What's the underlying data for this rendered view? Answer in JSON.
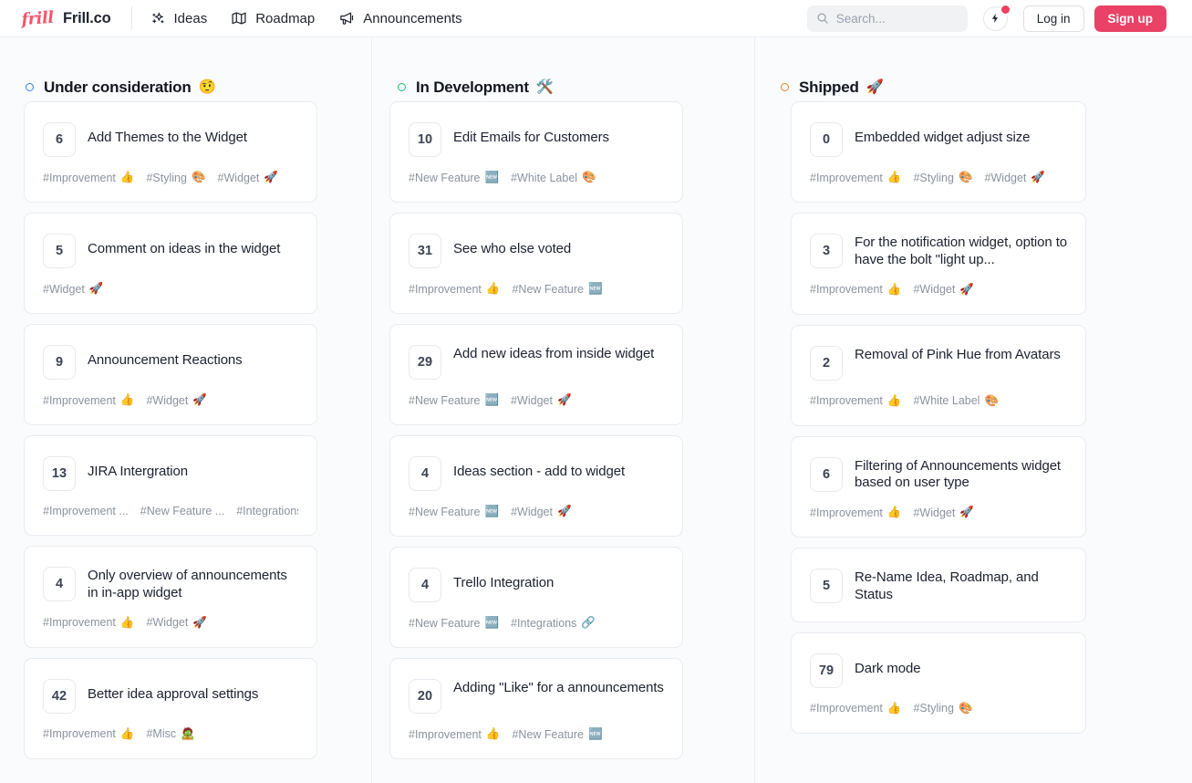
{
  "header": {
    "logo_icon": "frill-script-logo",
    "logo_text": "frill",
    "brand": "Frill.co",
    "nav": [
      {
        "label": "Ideas",
        "icon": "sparkles-icon"
      },
      {
        "label": "Roadmap",
        "icon": "map-icon"
      },
      {
        "label": "Announcements",
        "icon": "megaphone-icon"
      }
    ],
    "search": {
      "placeholder": "Search...",
      "value": "",
      "icon": "search-icon"
    },
    "bolt": {
      "icon": "bolt-icon",
      "has_notification": true,
      "dot_color": "#ef3e63"
    },
    "login_label": "Log in",
    "signup_label": "Sign up",
    "signup_color": "#e94266"
  },
  "board": {
    "columns": [
      {
        "title": "Under consideration",
        "emoji": "🤨",
        "emoji_name": "face-with-raised-eyebrow",
        "dot_color": "#2f7df4",
        "cards": [
          {
            "votes": "6",
            "title": "Add Themes to the Widget",
            "tags": [
              {
                "label": "#Improvement",
                "emoji": "👍"
              },
              {
                "label": "#Styling",
                "emoji": "🎨"
              },
              {
                "label": "#Widget",
                "emoji": "🚀"
              }
            ]
          },
          {
            "votes": "5",
            "title": "Comment on ideas in the widget",
            "tags": [
              {
                "label": "#Widget",
                "emoji": "🚀"
              }
            ]
          },
          {
            "votes": "9",
            "title": "Announcement Reactions",
            "tags": [
              {
                "label": "#Improvement",
                "emoji": "👍"
              },
              {
                "label": "#Widget",
                "emoji": "🚀"
              }
            ]
          },
          {
            "votes": "13",
            "title": "JIRA Intergration",
            "tags": [
              {
                "label": "#Improvement ...",
                "emoji": ""
              },
              {
                "label": "#New Feature ...",
                "emoji": ""
              },
              {
                "label": "#Integrations ...",
                "emoji": ""
              }
            ]
          },
          {
            "votes": "4",
            "title": "Only overview of announcements in in-app widget",
            "two_line": true,
            "tags": [
              {
                "label": "#Improvement",
                "emoji": "👍"
              },
              {
                "label": "#Widget",
                "emoji": "🚀"
              }
            ]
          },
          {
            "votes": "42",
            "title": "Better idea approval settings",
            "tags": [
              {
                "label": "#Improvement",
                "emoji": "👍"
              },
              {
                "label": "#Misc",
                "emoji": "🧟"
              }
            ]
          }
        ]
      },
      {
        "title": "In Development",
        "emoji": "🛠️",
        "emoji_name": "hammer-and-wrench",
        "dot_color": "#16c172",
        "cards": [
          {
            "votes": "10",
            "title": "Edit Emails for Customers",
            "tags": [
              {
                "label": "#New Feature",
                "emoji": "🆕"
              },
              {
                "label": "#White Label",
                "emoji": "🎨"
              }
            ]
          },
          {
            "votes": "31",
            "title": "See who else voted",
            "tags": [
              {
                "label": "#Improvement",
                "emoji": "👍"
              },
              {
                "label": "#New Feature",
                "emoji": "🆕"
              }
            ]
          },
          {
            "votes": "29",
            "title": "Add new ideas from inside widget",
            "two_line": true,
            "tags": [
              {
                "label": "#New Feature",
                "emoji": "🆕"
              },
              {
                "label": "#Widget",
                "emoji": "🚀"
              }
            ]
          },
          {
            "votes": "4",
            "title": "Ideas section - add to widget",
            "tags": [
              {
                "label": "#New Feature",
                "emoji": "🆕"
              },
              {
                "label": "#Widget",
                "emoji": "🚀"
              }
            ]
          },
          {
            "votes": "4",
            "title": "Trello Integration",
            "tags": [
              {
                "label": "#New Feature",
                "emoji": "🆕"
              },
              {
                "label": "#Integrations",
                "emoji": "🔗"
              }
            ]
          },
          {
            "votes": "20",
            "title": "Adding \"Like\" for a announcements",
            "two_line": true,
            "tags": [
              {
                "label": "#Improvement",
                "emoji": "👍"
              },
              {
                "label": "#New Feature",
                "emoji": "🆕"
              }
            ]
          }
        ]
      },
      {
        "title": "Shipped",
        "emoji": "🚀",
        "emoji_name": "rocket",
        "dot_color": "#f08324",
        "cards": [
          {
            "votes": "0",
            "title": "Embedded widget adjust size",
            "tags": [
              {
                "label": "#Improvement",
                "emoji": "👍"
              },
              {
                "label": "#Styling",
                "emoji": "🎨"
              },
              {
                "label": "#Widget",
                "emoji": "🚀"
              }
            ]
          },
          {
            "votes": "3",
            "title": "For the notification widget, option to have the bolt \"light up...",
            "two_line": true,
            "tags": [
              {
                "label": "#Improvement",
                "emoji": "👍"
              },
              {
                "label": "#Widget",
                "emoji": "🚀"
              }
            ]
          },
          {
            "votes": "2",
            "title": "Removal of Pink Hue from Avatars",
            "two_line": true,
            "tags": [
              {
                "label": "#Improvement",
                "emoji": "👍"
              },
              {
                "label": "#White Label",
                "emoji": "🎨"
              }
            ]
          },
          {
            "votes": "6",
            "title": "Filtering of Announcements widget based on user type",
            "two_line": true,
            "tags": [
              {
                "label": "#Improvement",
                "emoji": "👍"
              },
              {
                "label": "#Widget",
                "emoji": "🚀"
              }
            ]
          },
          {
            "votes": "5",
            "title": "Re-Name Idea, Roadmap, and Status",
            "two_line": true,
            "tags": []
          },
          {
            "votes": "79",
            "title": "Dark mode",
            "tags": [
              {
                "label": "#Improvement",
                "emoji": "👍"
              },
              {
                "label": "#Styling",
                "emoji": "🎨"
              }
            ]
          }
        ]
      }
    ]
  }
}
